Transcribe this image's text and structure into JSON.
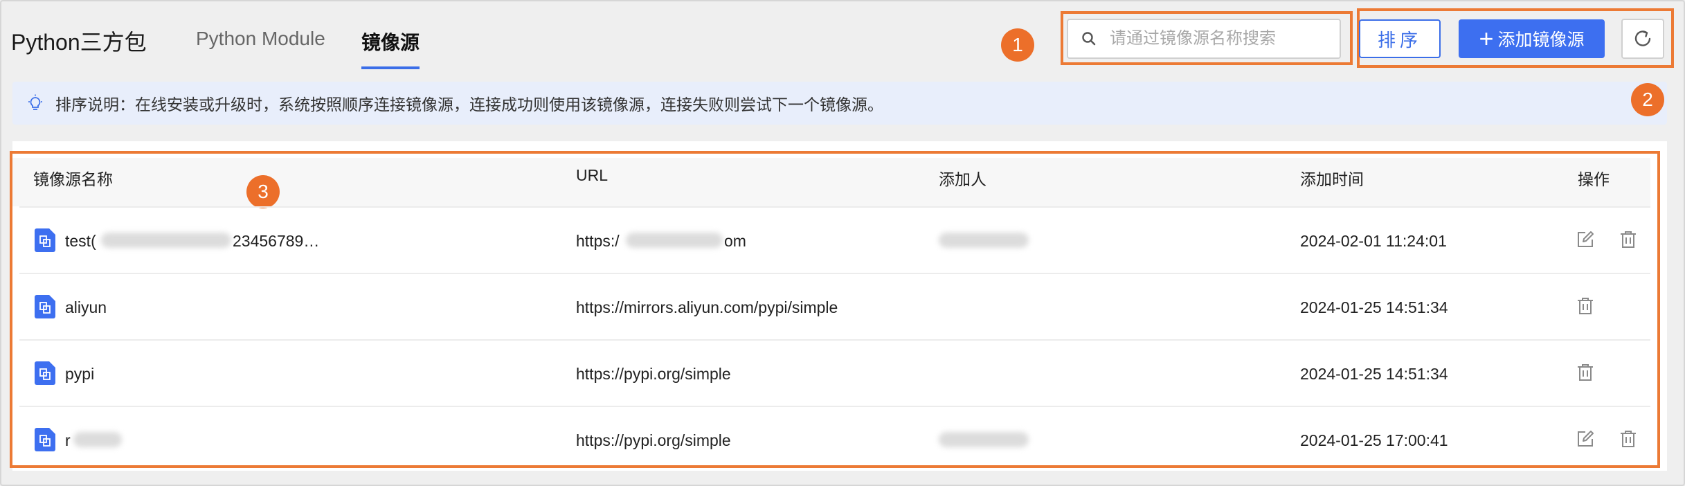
{
  "header": {
    "app_title": "Python三方包",
    "tabs": [
      {
        "label": "Python Module",
        "active": false
      },
      {
        "label": "镜像源",
        "active": true
      }
    ]
  },
  "search": {
    "placeholder": "请通过镜像源名称搜索",
    "value": ""
  },
  "toolbar": {
    "sort_label": "排序",
    "add_label": "添加镜像源"
  },
  "annotations": [
    "1",
    "2",
    "3"
  ],
  "notice": "排序说明：在线安装或升级时，系统按照顺序连接镜像源，连接成功则使用该镜像源，连接失败则尝试下一个镜像源。",
  "table": {
    "columns": [
      "镜像源名称",
      "URL",
      "添加人",
      "添加时间",
      "操作"
    ],
    "rows": [
      {
        "name_prefix": "test(",
        "name_suffix": "23456789…",
        "url_prefix": "https:/",
        "url_suffix": "om",
        "time": "2024-02-01 11:24:01",
        "editable": true
      },
      {
        "name": "aliyun",
        "url": "https://mirrors.aliyun.com/pypi/simple",
        "time": "2024-01-25 14:51:34",
        "editable": false
      },
      {
        "name": "pypi",
        "url": "https://pypi.org/simple",
        "time": "2024-01-25 14:51:34",
        "editable": false
      },
      {
        "name_prefix": "r",
        "url": "https://pypi.org/simple",
        "time": "2024-01-25 17:00:41",
        "editable": true
      }
    ]
  },
  "colors": {
    "accent": "#3d6ff0",
    "highlight": "#ec7a35",
    "notice_bg": "#e8eefb"
  }
}
